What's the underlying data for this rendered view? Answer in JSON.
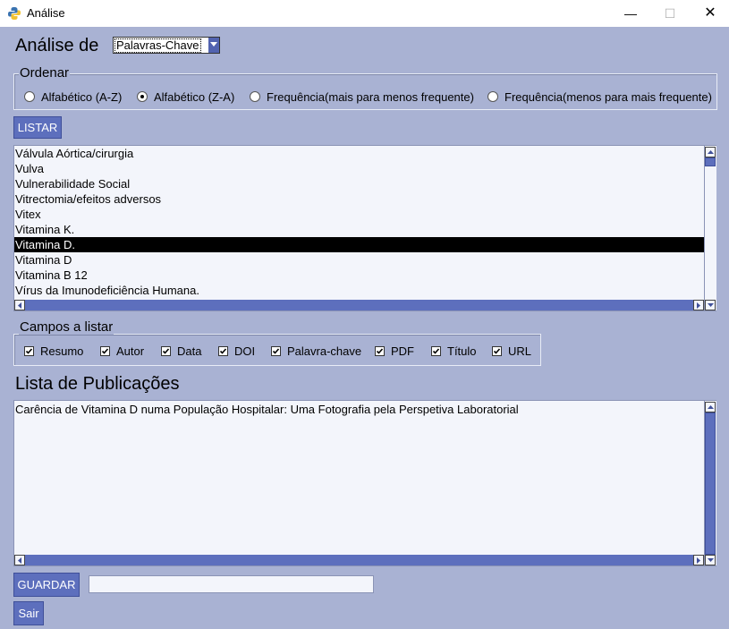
{
  "window": {
    "title": "Análise",
    "controls": {
      "minimize": "—",
      "maximize": "☐",
      "close": "✕"
    }
  },
  "analise": {
    "label": "Análise de",
    "selected": "Palavras-Chave"
  },
  "ordenar": {
    "title": "Ordenar",
    "options": [
      {
        "label": "Alfabético (A-Z)",
        "selected": false
      },
      {
        "label": "Alfabético (Z-A)",
        "selected": true
      },
      {
        "label": "Frequência(mais para menos frequente)",
        "selected": false
      },
      {
        "label": "Frequência(menos para mais frequente)",
        "selected": false
      }
    ]
  },
  "listar_label": "LISTAR",
  "keywords": {
    "items": [
      "Válvula Aórtica/cirurgia",
      "Vulva",
      "Vulnerabilidade Social",
      "Vitrectomia/efeitos adversos",
      "Vitex",
      "Vitamina K.",
      "Vitamina D.",
      "Vitamina D",
      "Vitamina B 12",
      "Vírus da Imunodeficiência Humana."
    ],
    "selected_index": 6
  },
  "campos": {
    "title": "Campos a listar",
    "fields": [
      {
        "label": "Resumo",
        "checked": true
      },
      {
        "label": "Autor",
        "checked": true
      },
      {
        "label": "Data",
        "checked": true
      },
      {
        "label": "DOI",
        "checked": true
      },
      {
        "label": "Palavra-chave",
        "checked": true
      },
      {
        "label": "PDF",
        "checked": true
      },
      {
        "label": "Título",
        "checked": true
      },
      {
        "label": "URL",
        "checked": true
      }
    ]
  },
  "publicacoes": {
    "heading": "Lista de Publicações",
    "text": "Carência de Vitamina D numa População Hospitalar: Uma Fotografia pela Perspetiva Laboratorial"
  },
  "guardar": {
    "label": "GUARDAR",
    "value": ""
  },
  "sair_label": "Sair",
  "colors": {
    "background": "#a9b2d3",
    "button": "#5d6fbd",
    "selection": "#000000"
  }
}
